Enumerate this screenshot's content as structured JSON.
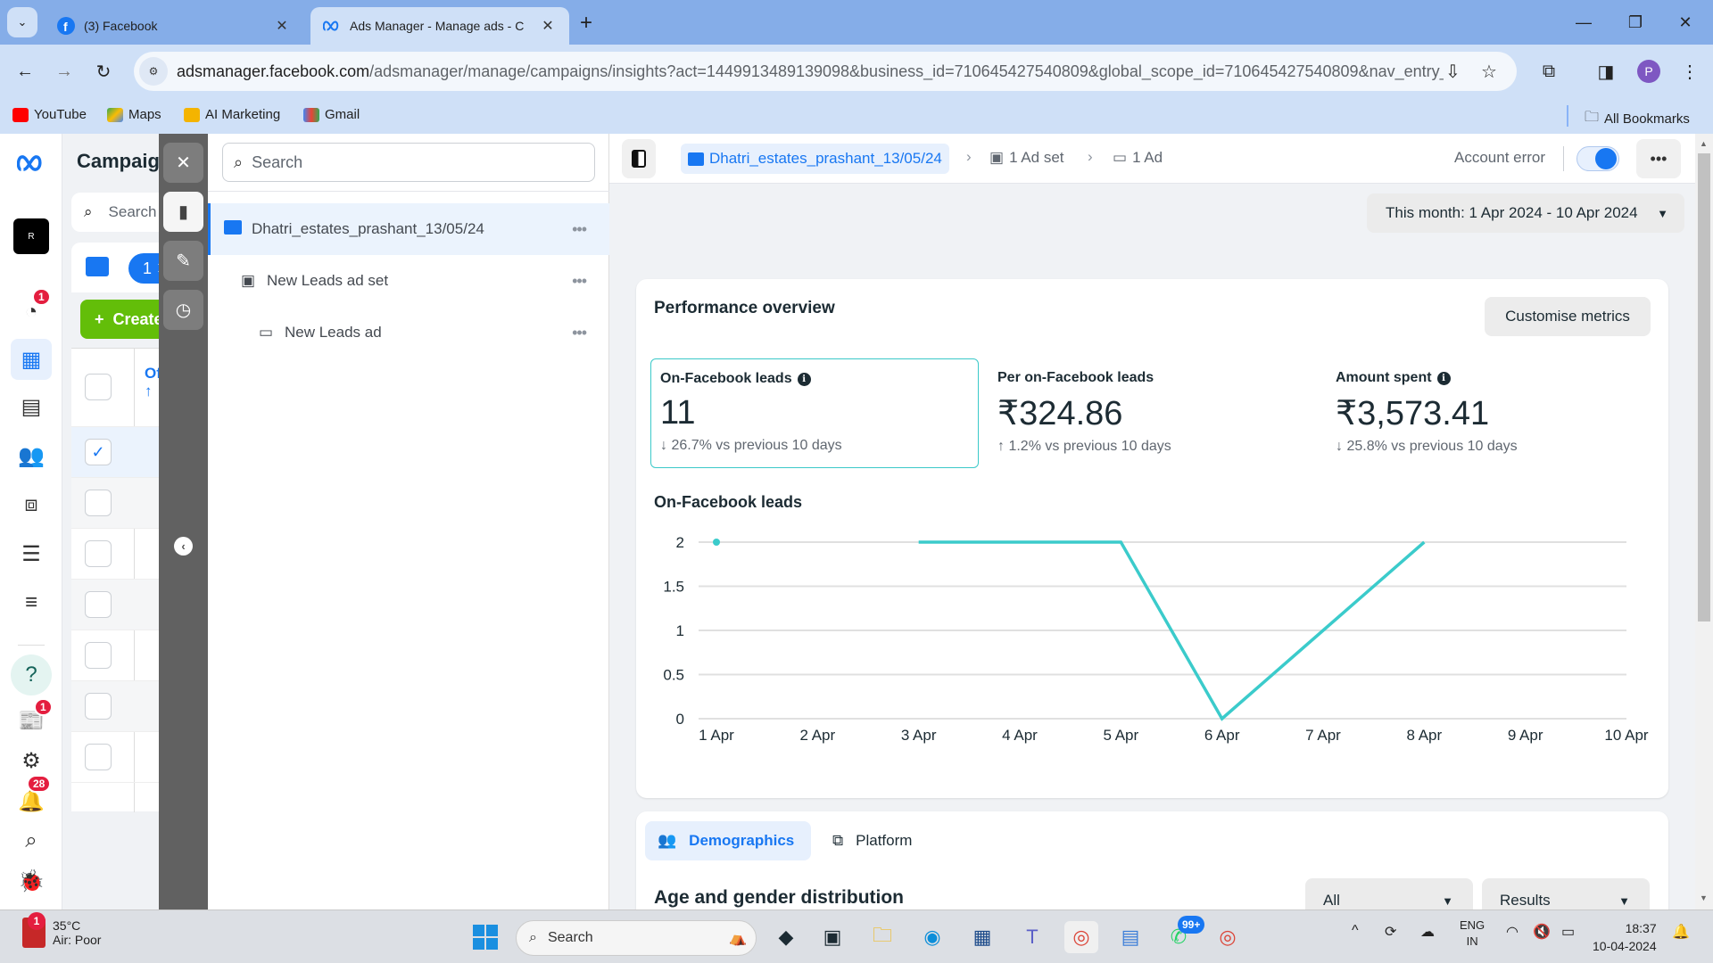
{
  "browser": {
    "tabs": [
      {
        "title": "(3) Facebook",
        "icon": "facebook-icon",
        "active": false
      },
      {
        "title": "Ads Manager - Manage ads - C",
        "icon": "meta-icon",
        "active": true
      }
    ],
    "url_host": "adsmanager.facebook.com",
    "url_path": "/adsmanager/manage/campaigns/insights?act=1449913489139098&business_id=710645427540809&global_scope_id=710645427540809&nav_entry_poin...",
    "profile_initial": "P",
    "bookmarks": [
      {
        "label": "YouTube",
        "color": "#ff0000"
      },
      {
        "label": "Maps",
        "color": "#34a853"
      },
      {
        "label": "AI Marketing",
        "color": "#f4b400"
      },
      {
        "label": "Gmail",
        "color": "#ea4335"
      }
    ],
    "all_bookmarks": "All Bookmarks"
  },
  "leftnav": {
    "badges": {
      "tools": "1",
      "news": "1",
      "notifications": "28"
    }
  },
  "campaigns_panel": {
    "title": "Campaigns",
    "search_placeholder": "Search",
    "selected_count": "1",
    "create_label": "Create",
    "column_header": "Off"
  },
  "tree": {
    "search_placeholder": "Search",
    "items": [
      {
        "label": "Dhatri_estates_prashant_13/05/24",
        "type": "campaign"
      },
      {
        "label": "New Leads ad set",
        "type": "adset"
      },
      {
        "label": "New Leads ad",
        "type": "ad"
      }
    ]
  },
  "header": {
    "campaign": "Dhatri_estates_prashant_13/05/24",
    "adset": "1 Ad set",
    "ad": "1 Ad",
    "account_status": "Account error",
    "date_range": "This month: 1 Apr 2024 - 10 Apr 2024"
  },
  "performance": {
    "title": "Performance overview",
    "customise_label": "Customise metrics",
    "metrics": [
      {
        "label": "On-Facebook leads",
        "value": "11",
        "change": "26.7% vs previous 10 days",
        "direction": "down",
        "info": true
      },
      {
        "label": "Per on-Facebook leads",
        "value": "₹324.86",
        "change": "1.2% vs previous 10 days",
        "direction": "up",
        "info": false
      },
      {
        "label": "Amount spent",
        "value": "₹3,573.41",
        "change": "25.8% vs previous 10 days",
        "direction": "down",
        "info": true
      }
    ],
    "chart_title": "On-Facebook leads"
  },
  "chart_data": {
    "type": "line",
    "title": "On-Facebook leads",
    "x": [
      "1 Apr",
      "2 Apr",
      "3 Apr",
      "4 Apr",
      "5 Apr",
      "6 Apr",
      "7 Apr",
      "8 Apr",
      "9 Apr",
      "10 Apr"
    ],
    "series": [
      {
        "name": "On-Facebook leads",
        "values": [
          2,
          null,
          2,
          2,
          2,
          0,
          1,
          2,
          null,
          null
        ],
        "color": "#3bcbcb"
      }
    ],
    "yticks": [
      "0",
      "0.5",
      "1",
      "1.5",
      "2"
    ],
    "ylim": [
      0,
      2
    ],
    "xlabel": "",
    "ylabel": "",
    "grid": true
  },
  "breakdown": {
    "tabs": [
      "Demographics",
      "Platform"
    ],
    "section_title": "Age and gender distribution",
    "filter1": "All",
    "filter2": "Results"
  },
  "taskbar": {
    "weather_temp": "35°C",
    "weather_desc": "Air: Poor",
    "weather_badge": "1",
    "search_placeholder": "Search",
    "whatsapp_badge": "99+",
    "lang1": "ENG",
    "lang2": "IN",
    "time": "18:37",
    "date": "10-04-2024"
  }
}
